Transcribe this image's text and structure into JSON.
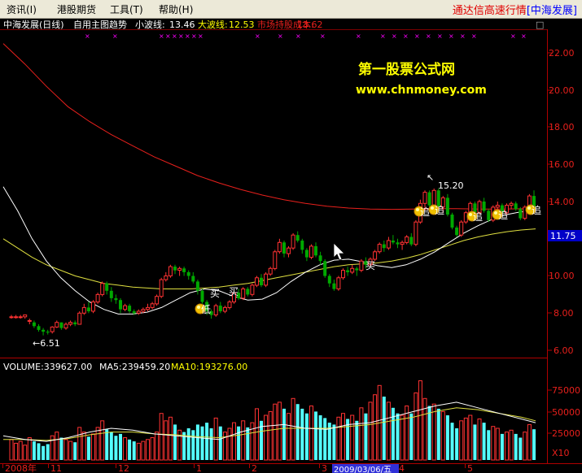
{
  "menu": {
    "items": [
      "资讯(I)",
      "港股期货",
      "工具(T)",
      "帮助(H)"
    ],
    "app_title": "通达信高速行情",
    "app_title_suffix": "[中海发展]"
  },
  "header": {
    "stock": "中海发展(日线)",
    "formula": "自用主图趋势",
    "small_wave_label": "小波线:",
    "small_wave_value": "13.46",
    "big_wave_label": "大波线:",
    "big_wave_value": "12.53",
    "cost_label": "市场持股成本:",
    "cost_value": "13.62",
    "close_glyph": "□"
  },
  "watermark": {
    "line1": "第一股票公式网",
    "line2": "www.chnmoney.com"
  },
  "price_axis": {
    "ticks": [
      "22.00",
      "20.00",
      "18.00",
      "16.00",
      "14.00",
      "11.75",
      "10.00",
      "8.00",
      "6.00"
    ],
    "current_price": "11.75"
  },
  "annotations": {
    "low_marker": "←6.51",
    "high_marker": "15.20",
    "signals": [
      {
        "text": "低",
        "kind": "coin"
      },
      {
        "text": "买",
        "kind": "text"
      },
      {
        "text": "买",
        "kind": "text"
      },
      {
        "text": "买",
        "kind": "text"
      },
      {
        "text": "追",
        "kind": "coin"
      },
      {
        "text": "追",
        "kind": "coin"
      },
      {
        "text": "追",
        "kind": "coin"
      },
      {
        "text": "追",
        "kind": "coin"
      },
      {
        "text": "追",
        "kind": "coin"
      }
    ]
  },
  "volume": {
    "volume_label": "VOLUME:339627.00",
    "ma5_label": "MA5:239459.20",
    "ma10_label": "MA10:193276.00",
    "axis_ticks": [
      "75000",
      "50000",
      "25000"
    ],
    "unit": "X10"
  },
  "date_axis": {
    "labels": [
      "2008年",
      "11",
      "12",
      "1",
      "2",
      "3",
      "4",
      "5"
    ],
    "cursor_date": "2009/03/06/五"
  },
  "colors": {
    "up": "#ff3232",
    "down": "#00a800",
    "vol_down": "#54ffff",
    "cost_line": "#e8201c",
    "small_wave": "#ffffff",
    "big_wave": "#e0e040",
    "axis_red": "#b00000",
    "magenta_marks": "#ff00ff"
  },
  "chart_data": {
    "type": "candlestick",
    "title": "中海发展(日线)",
    "price_axis_range": [
      5.6,
      23.6
    ],
    "volume_axis_range": [
      0,
      95000
    ],
    "candles": [
      [
        7.8,
        7.9,
        7.7,
        7.8
      ],
      [
        7.8,
        7.9,
        7.7,
        7.8
      ],
      [
        7.8,
        7.9,
        7.7,
        7.8
      ],
      [
        7.8,
        7.9,
        7.7,
        7.9
      ],
      [
        7.6,
        7.7,
        7.4,
        7.6
      ],
      [
        7.5,
        7.6,
        7.2,
        7.3
      ],
      [
        7.3,
        7.4,
        7.0,
        7.1
      ],
      [
        7.1,
        7.2,
        6.8,
        7.0
      ],
      [
        7.0,
        7.1,
        6.85,
        6.95
      ],
      [
        7.0,
        7.3,
        6.9,
        7.25
      ],
      [
        7.25,
        7.6,
        7.2,
        7.5
      ],
      [
        7.5,
        7.5,
        7.1,
        7.2
      ],
      [
        7.2,
        7.5,
        7.1,
        7.4
      ],
      [
        7.4,
        7.6,
        7.3,
        7.5
      ],
      [
        7.5,
        7.6,
        7.3,
        7.4
      ],
      [
        7.4,
        8.1,
        7.4,
        8.0
      ],
      [
        8.0,
        8.5,
        7.9,
        8.3
      ],
      [
        8.3,
        8.6,
        8.0,
        8.1
      ],
      [
        8.1,
        8.7,
        8.0,
        8.6
      ],
      [
        8.6,
        9.1,
        8.5,
        9.0
      ],
      [
        9.0,
        9.7,
        8.9,
        9.6
      ],
      [
        9.6,
        9.7,
        9.0,
        9.2
      ],
      [
        9.2,
        9.4,
        8.6,
        8.8
      ],
      [
        8.8,
        9.0,
        8.5,
        8.7
      ],
      [
        8.7,
        8.8,
        8.0,
        8.2
      ],
      [
        8.2,
        8.5,
        8.1,
        8.4
      ],
      [
        8.4,
        8.5,
        8.0,
        8.1
      ],
      [
        8.1,
        8.2,
        7.9,
        8.0
      ],
      [
        8.0,
        8.2,
        7.9,
        8.1
      ],
      [
        8.1,
        8.3,
        8.0,
        8.2
      ],
      [
        8.2,
        8.5,
        8.1,
        8.3
      ],
      [
        8.3,
        8.6,
        8.2,
        8.5
      ],
      [
        8.5,
        9.0,
        8.4,
        8.9
      ],
      [
        8.9,
        9.9,
        8.8,
        9.8
      ],
      [
        9.8,
        10.2,
        9.7,
        10.0
      ],
      [
        10.0,
        10.6,
        9.9,
        10.5
      ],
      [
        10.5,
        10.6,
        10.1,
        10.3
      ],
      [
        10.3,
        10.5,
        10.0,
        10.4
      ],
      [
        10.4,
        10.5,
        10.0,
        10.2
      ],
      [
        10.2,
        10.3,
        9.8,
        10.0
      ],
      [
        10.0,
        10.2,
        9.6,
        9.7
      ],
      [
        9.7,
        9.8,
        9.0,
        9.2
      ],
      [
        9.2,
        9.3,
        8.5,
        8.6
      ],
      [
        8.6,
        8.7,
        7.9,
        8.1
      ],
      [
        8.1,
        8.2,
        7.7,
        7.9
      ],
      [
        7.9,
        8.5,
        7.8,
        8.4
      ],
      [
        8.4,
        8.6,
        8.0,
        8.1
      ],
      [
        8.1,
        8.4,
        8.0,
        8.3
      ],
      [
        8.3,
        8.7,
        8.2,
        8.6
      ],
      [
        8.6,
        9.2,
        8.5,
        9.1
      ],
      [
        9.1,
        9.3,
        8.7,
        8.8
      ],
      [
        8.8,
        9.4,
        8.7,
        9.3
      ],
      [
        9.3,
        9.4,
        8.9,
        9.0
      ],
      [
        9.0,
        9.6,
        8.9,
        9.5
      ],
      [
        9.5,
        10.0,
        9.4,
        9.9
      ],
      [
        9.9,
        10.1,
        9.4,
        9.5
      ],
      [
        9.5,
        10.2,
        9.4,
        10.1
      ],
      [
        10.1,
        10.5,
        10.0,
        10.4
      ],
      [
        10.4,
        11.4,
        10.3,
        11.3
      ],
      [
        11.3,
        12.0,
        11.2,
        11.8
      ],
      [
        11.8,
        11.9,
        11.0,
        11.2
      ],
      [
        11.2,
        11.6,
        11.0,
        11.5
      ],
      [
        11.5,
        12.3,
        11.4,
        12.2
      ],
      [
        12.2,
        12.4,
        11.8,
        11.9
      ],
      [
        11.9,
        12.0,
        11.2,
        11.4
      ],
      [
        11.4,
        11.5,
        10.8,
        11.0
      ],
      [
        11.0,
        11.7,
        10.9,
        11.6
      ],
      [
        11.6,
        11.8,
        11.0,
        11.1
      ],
      [
        11.1,
        11.3,
        10.6,
        10.8
      ],
      [
        10.8,
        10.9,
        9.9,
        10.0
      ],
      [
        10.0,
        10.1,
        9.4,
        9.6
      ],
      [
        9.6,
        9.8,
        9.2,
        9.3
      ],
      [
        9.3,
        10.0,
        9.2,
        9.9
      ],
      [
        9.9,
        10.4,
        9.8,
        10.3
      ],
      [
        10.3,
        10.5,
        10.0,
        10.2
      ],
      [
        10.2,
        10.6,
        10.1,
        10.4
      ],
      [
        10.4,
        10.5,
        10.0,
        10.3
      ],
      [
        10.3,
        10.9,
        10.2,
        10.8
      ],
      [
        10.8,
        11.0,
        10.4,
        10.6
      ],
      [
        10.6,
        11.0,
        10.5,
        10.9
      ],
      [
        10.9,
        11.4,
        10.8,
        11.3
      ],
      [
        11.3,
        11.8,
        11.2,
        11.7
      ],
      [
        11.7,
        11.9,
        11.3,
        11.5
      ],
      [
        11.5,
        12.1,
        11.4,
        11.9
      ],
      [
        11.9,
        12.2,
        11.7,
        11.8
      ],
      [
        11.8,
        12.0,
        11.5,
        11.7
      ],
      [
        11.7,
        11.9,
        11.4,
        11.8
      ],
      [
        11.8,
        12.2,
        11.7,
        12.1
      ],
      [
        12.1,
        12.3,
        11.6,
        11.7
      ],
      [
        11.7,
        13.0,
        11.6,
        12.9
      ],
      [
        12.9,
        14.1,
        12.8,
        13.9
      ],
      [
        13.9,
        14.6,
        13.5,
        14.5
      ],
      [
        14.5,
        14.6,
        13.7,
        13.8
      ],
      [
        13.8,
        14.7,
        13.7,
        14.6
      ],
      [
        14.6,
        14.7,
        13.6,
        13.7
      ],
      [
        13.7,
        14.3,
        13.4,
        14.2
      ],
      [
        14.2,
        14.4,
        13.2,
        13.3
      ],
      [
        13.3,
        13.4,
        12.5,
        12.6
      ],
      [
        12.6,
        12.7,
        12.1,
        12.2
      ],
      [
        12.2,
        13.0,
        12.1,
        12.9
      ],
      [
        12.9,
        13.5,
        12.8,
        13.4
      ],
      [
        13.4,
        14.0,
        13.3,
        13.9
      ],
      [
        13.9,
        14.0,
        13.3,
        13.4
      ],
      [
        13.4,
        14.1,
        13.3,
        14.0
      ],
      [
        14.0,
        14.2,
        13.4,
        13.5
      ],
      [
        13.5,
        13.6,
        12.9,
        13.0
      ],
      [
        13.0,
        13.8,
        12.9,
        13.7
      ],
      [
        13.7,
        14.0,
        13.5,
        13.8
      ],
      [
        13.8,
        13.9,
        13.3,
        13.4
      ],
      [
        13.4,
        13.9,
        13.3,
        13.8
      ],
      [
        13.8,
        14.0,
        13.6,
        13.9
      ],
      [
        13.9,
        14.0,
        13.5,
        13.6
      ],
      [
        13.6,
        13.7,
        13.0,
        13.1
      ],
      [
        13.1,
        13.8,
        13.0,
        13.7
      ],
      [
        13.7,
        14.4,
        13.6,
        14.3
      ],
      [
        14.3,
        14.6,
        13.5,
        13.6
      ]
    ],
    "volumes": [
      22000,
      18000,
      20000,
      16000,
      24000,
      20000,
      18000,
      15000,
      17000,
      26000,
      30000,
      24000,
      22000,
      20000,
      19000,
      35000,
      30000,
      25000,
      28000,
      35000,
      42000,
      33000,
      30000,
      26000,
      28000,
      24000,
      22000,
      20000,
      18000,
      20000,
      22000,
      24000,
      30000,
      50000,
      42000,
      46000,
      38000,
      32000,
      30000,
      34000,
      32000,
      38000,
      36000,
      40000,
      34000,
      45000,
      36000,
      30000,
      34000,
      40000,
      36000,
      42000,
      35000,
      40000,
      55000,
      42000,
      48000,
      52000,
      60000,
      62000,
      55000,
      50000,
      66000,
      60000,
      55000,
      50000,
      58000,
      52000,
      48000,
      45000,
      40000,
      38000,
      46000,
      50000,
      44000,
      48000,
      42000,
      56000,
      50000,
      62000,
      70000,
      80000,
      68000,
      62000,
      56000,
      50000,
      48000,
      58000,
      50000,
      72000,
      85000,
      66000,
      58000,
      60000,
      55000,
      52000,
      48000,
      40000,
      34000,
      42000,
      45000,
      48000,
      38000,
      44000,
      40000,
      32000,
      36000,
      34000,
      28000,
      30000,
      32000,
      28000,
      24000,
      30000,
      38000,
      33000
    ],
    "small_wave_line": [
      [
        0,
        14.8
      ],
      [
        8,
        13.5
      ],
      [
        16,
        12.0
      ],
      [
        24,
        10.8
      ],
      [
        32,
        9.9
      ],
      [
        40,
        9.2
      ],
      [
        48,
        8.6
      ],
      [
        56,
        8.2
      ],
      [
        64,
        7.95
      ],
      [
        72,
        7.95
      ],
      [
        80,
        8.05
      ],
      [
        88,
        8.3
      ],
      [
        96,
        8.7
      ],
      [
        104,
        9.1
      ],
      [
        112,
        9.3
      ],
      [
        120,
        9.2
      ],
      [
        128,
        8.9
      ],
      [
        136,
        8.7
      ],
      [
        144,
        8.75
      ],
      [
        152,
        9.1
      ],
      [
        160,
        9.7
      ],
      [
        168,
        10.2
      ],
      [
        176,
        10.6
      ],
      [
        184,
        10.85
      ],
      [
        192,
        10.9
      ],
      [
        200,
        10.75
      ],
      [
        208,
        10.55
      ],
      [
        216,
        10.45
      ],
      [
        224,
        10.6
      ],
      [
        232,
        10.9
      ],
      [
        240,
        11.3
      ],
      [
        248,
        11.8
      ],
      [
        256,
        12.3
      ],
      [
        264,
        12.7
      ],
      [
        272,
        13.05
      ],
      [
        280,
        13.3
      ],
      [
        288,
        13.45
      ],
      [
        296,
        13.46
      ]
    ],
    "big_wave_line": [
      [
        0,
        12.0
      ],
      [
        8,
        11.5
      ],
      [
        16,
        11.0
      ],
      [
        24,
        10.6
      ],
      [
        32,
        10.3
      ],
      [
        40,
        10.0
      ],
      [
        48,
        9.8
      ],
      [
        56,
        9.6
      ],
      [
        64,
        9.5
      ],
      [
        72,
        9.4
      ],
      [
        80,
        9.35
      ],
      [
        88,
        9.3
      ],
      [
        96,
        9.3
      ],
      [
        104,
        9.3
      ],
      [
        112,
        9.35
      ],
      [
        120,
        9.4
      ],
      [
        128,
        9.5
      ],
      [
        136,
        9.6
      ],
      [
        144,
        9.75
      ],
      [
        152,
        9.9
      ],
      [
        160,
        10.05
      ],
      [
        168,
        10.2
      ],
      [
        176,
        10.35
      ],
      [
        184,
        10.5
      ],
      [
        192,
        10.6
      ],
      [
        200,
        10.65
      ],
      [
        208,
        10.7
      ],
      [
        216,
        10.8
      ],
      [
        224,
        10.95
      ],
      [
        232,
        11.15
      ],
      [
        240,
        11.4
      ],
      [
        248,
        11.65
      ],
      [
        256,
        11.9
      ],
      [
        264,
        12.1
      ],
      [
        272,
        12.25
      ],
      [
        280,
        12.38
      ],
      [
        288,
        12.47
      ],
      [
        296,
        12.53
      ]
    ],
    "cost_line": [
      [
        0,
        22.5
      ],
      [
        12,
        21.4
      ],
      [
        24,
        20.2
      ],
      [
        36,
        19.1
      ],
      [
        48,
        18.3
      ],
      [
        60,
        17.6
      ],
      [
        72,
        17.0
      ],
      [
        84,
        16.4
      ],
      [
        96,
        15.9
      ],
      [
        108,
        15.4
      ],
      [
        120,
        15.0
      ],
      [
        132,
        14.65
      ],
      [
        144,
        14.35
      ],
      [
        156,
        14.1
      ],
      [
        168,
        13.9
      ],
      [
        180,
        13.75
      ],
      [
        192,
        13.65
      ],
      [
        204,
        13.6
      ],
      [
        216,
        13.58
      ],
      [
        228,
        13.6
      ],
      [
        240,
        13.62
      ],
      [
        252,
        13.62
      ],
      [
        264,
        13.6
      ],
      [
        276,
        13.6
      ],
      [
        288,
        13.61
      ],
      [
        296,
        13.62
      ]
    ],
    "volume_ma5_line": [
      [
        0,
        26000
      ],
      [
        12,
        22000
      ],
      [
        24,
        20000
      ],
      [
        36,
        24000
      ],
      [
        48,
        30000
      ],
      [
        60,
        34000
      ],
      [
        72,
        32000
      ],
      [
        84,
        28000
      ],
      [
        96,
        26000
      ],
      [
        108,
        24000
      ],
      [
        120,
        22000
      ],
      [
        132,
        30000
      ],
      [
        144,
        36000
      ],
      [
        156,
        38000
      ],
      [
        168,
        34000
      ],
      [
        180,
        33000
      ],
      [
        192,
        38000
      ],
      [
        204,
        40000
      ],
      [
        216,
        46000
      ],
      [
        228,
        52000
      ],
      [
        240,
        58000
      ],
      [
        252,
        62000
      ],
      [
        264,
        56000
      ],
      [
        276,
        50000
      ],
      [
        288,
        44000
      ],
      [
        296,
        40000
      ]
    ],
    "volume_ma10_line": [
      [
        0,
        22000
      ],
      [
        12,
        22000
      ],
      [
        24,
        21000
      ],
      [
        36,
        23000
      ],
      [
        48,
        27000
      ],
      [
        60,
        30000
      ],
      [
        72,
        30000
      ],
      [
        84,
        28000
      ],
      [
        96,
        27000
      ],
      [
        108,
        25000
      ],
      [
        120,
        24000
      ],
      [
        132,
        27000
      ],
      [
        144,
        31000
      ],
      [
        156,
        34000
      ],
      [
        168,
        34000
      ],
      [
        180,
        34000
      ],
      [
        192,
        36000
      ],
      [
        204,
        38000
      ],
      [
        216,
        42000
      ],
      [
        228,
        46000
      ],
      [
        240,
        52000
      ],
      [
        252,
        56000
      ],
      [
        264,
        54000
      ],
      [
        276,
        50000
      ],
      [
        288,
        46000
      ],
      [
        296,
        42000
      ]
    ]
  }
}
